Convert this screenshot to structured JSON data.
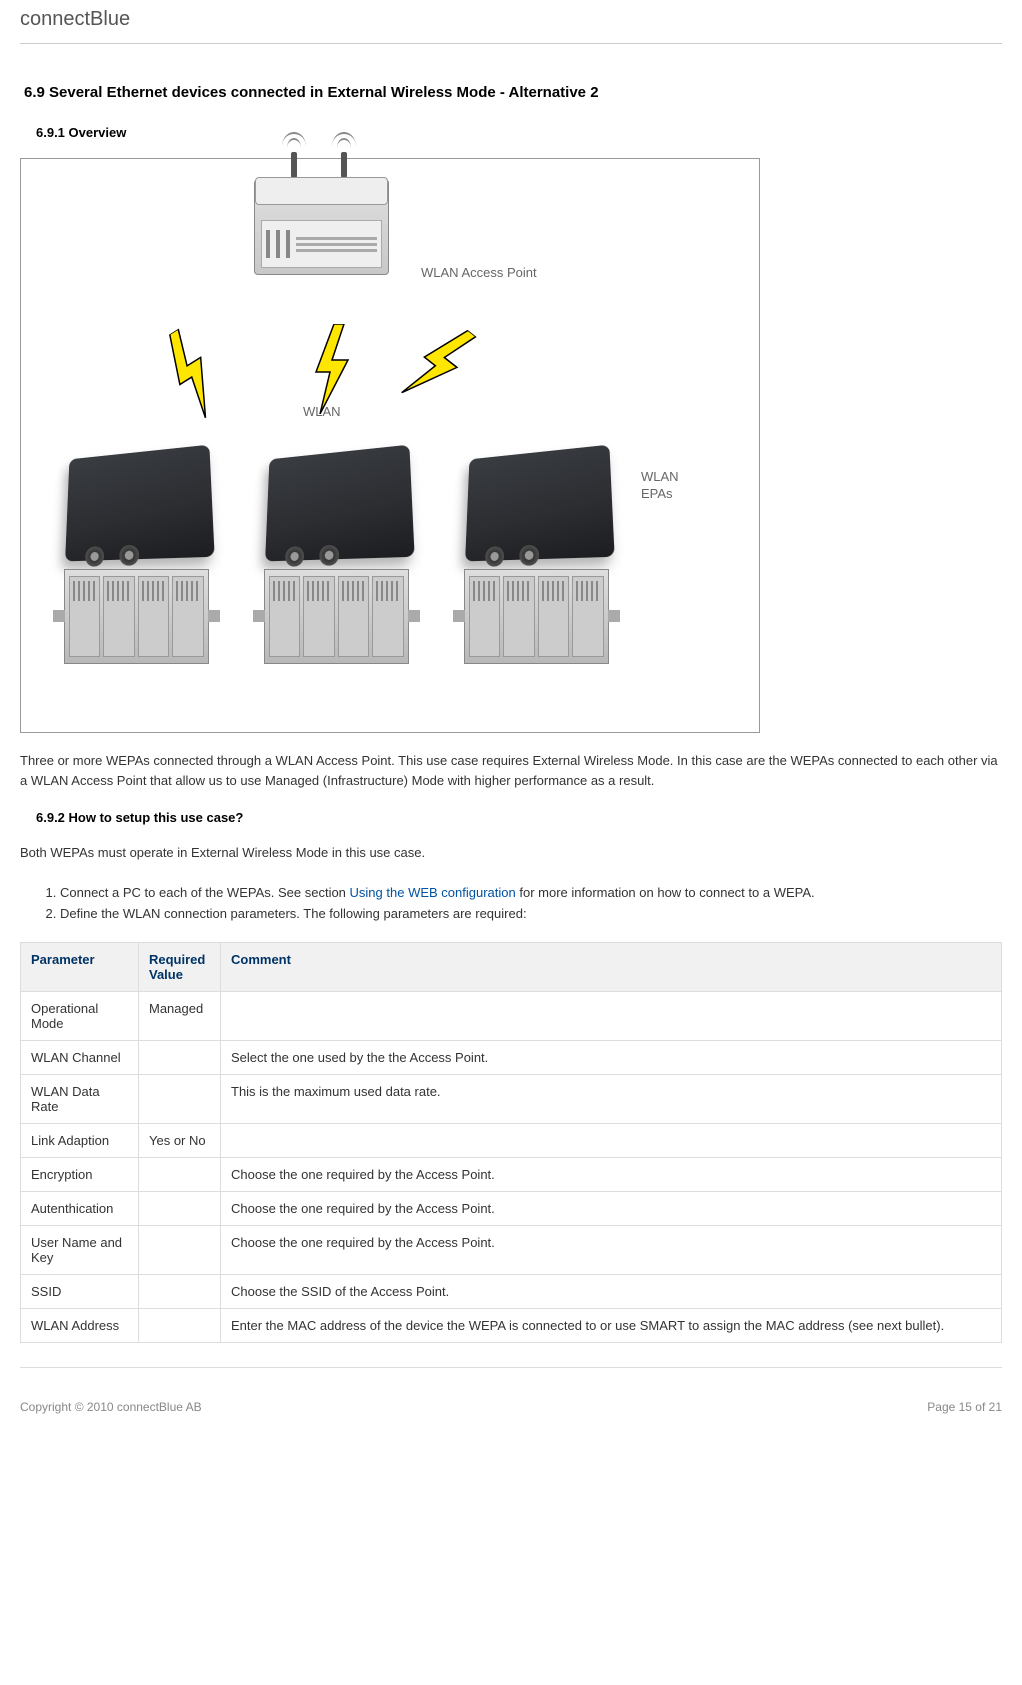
{
  "header": {
    "brand": "connectBlue"
  },
  "headings": {
    "section": "6.9 Several Ethernet devices connected in External Wireless Mode - Alternative 2",
    "overview": "6.9.1 Overview",
    "howto": "6.9.2 How to setup this use case?"
  },
  "diagram": {
    "ap_label": "WLAN Access Point",
    "wlan_label": "WLAN",
    "epa_label_line1": "WLAN",
    "epa_label_line2": "EPAs"
  },
  "paragraphs": {
    "overview_text": "Three or more WEPAs connected through a WLAN Access Point. This use case requires External Wireless Mode. In this case are  the WEPAs connected to each other via a WLAN Access Point that allow us to use Managed (Infrastructure) Mode with higher performance as a result.",
    "howto_intro": "Both WEPAs must operate in External Wireless Mode in this use case."
  },
  "steps": {
    "s1_prefix": "Connect a PC to each of the WEPAs. See section ",
    "s1_link": "Using the WEB configuration",
    "s1_suffix": " for more information on how to connect to a WEPA.",
    "s2": "Define the WLAN connection parameters. The following parameters are required:"
  },
  "table": {
    "headers": {
      "param": "Parameter",
      "value": "Required Value",
      "comment": "Comment"
    },
    "rows": [
      {
        "param": "Operational Mode",
        "value": "Managed",
        "comment": ""
      },
      {
        "param": "WLAN Channel",
        "value": "",
        "comment": "Select the one used by the the Access Point."
      },
      {
        "param": "WLAN Data Rate",
        "value": "",
        "comment": "This is the maximum used data rate."
      },
      {
        "param": "Link Adaption",
        "value": "Yes or No",
        "comment": ""
      },
      {
        "param": "Encryption",
        "value": "",
        "comment": "Choose the one required by the Access Point."
      },
      {
        "param": "Autenthication",
        "value": "",
        "comment": "Choose the one required by the Access Point."
      },
      {
        "param": "User Name and Key",
        "value": "",
        "comment": "Choose the one required by the Access Point."
      },
      {
        "param": "SSID",
        "value": "",
        "comment": "Choose the SSID of the Access Point."
      },
      {
        "param": "WLAN Address",
        "value": "",
        "comment": "Enter the MAC address of the device the WEPA is connected to or use SMART to assign the MAC address (see next bullet)."
      }
    ]
  },
  "footer": {
    "copyright": "Copyright © 2010 connectBlue AB",
    "page": "Page 15 of 21"
  }
}
